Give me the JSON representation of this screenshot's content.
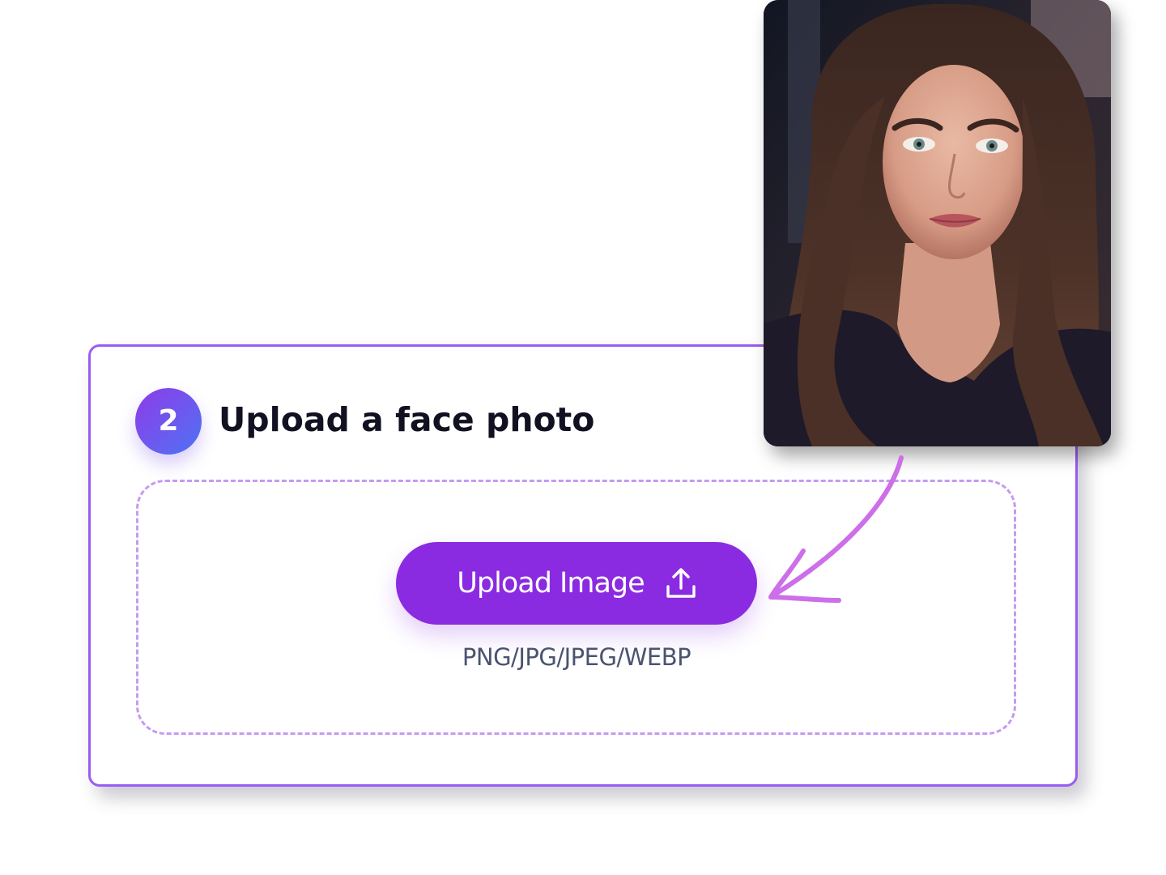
{
  "step": {
    "number": "2",
    "title": "Upload a face photo"
  },
  "upload": {
    "button_label": "Upload Image",
    "button_icon": "upload-icon",
    "formats": "PNG/JPG/JPEG/WEBP"
  },
  "preview": {
    "alt": "face photo example"
  },
  "colors": {
    "accent": "#8a2be2",
    "card_border": "#9b5cf2",
    "dashed_border": "#c39bf2",
    "arrow": "#cc6fe8",
    "title_text": "#111122",
    "muted_text": "#4a5470"
  }
}
